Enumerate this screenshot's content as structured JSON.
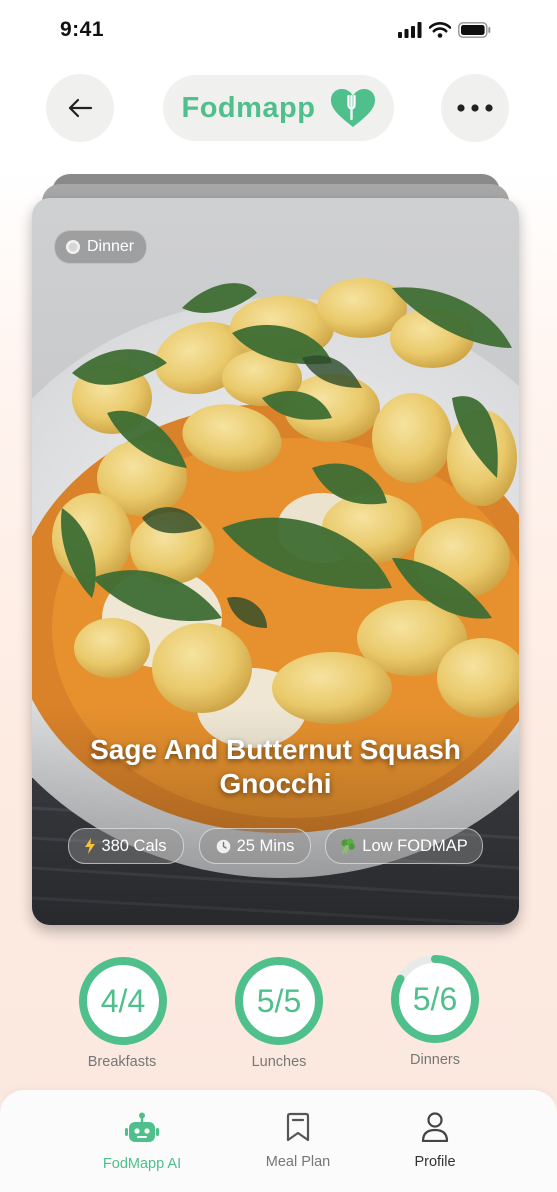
{
  "status_bar": {
    "time": "9:41"
  },
  "header": {
    "brand": "Fodmapp"
  },
  "recipe": {
    "meal_type": "Dinner",
    "title_line1": "Sage And Butternut Squash",
    "title_line2": "Gnocchi",
    "calories": "380 Cals",
    "time": "25 Mins",
    "diet": "Low FODMAP"
  },
  "progress": [
    {
      "label": "4/4",
      "caption": "Breakfasts",
      "fraction": 1.0
    },
    {
      "label": "5/5",
      "caption": "Lunches",
      "fraction": 1.0
    },
    {
      "label": "5/6",
      "caption": "Dinners",
      "fraction": 0.833
    }
  ],
  "nav": {
    "items": [
      {
        "label": "FodMapp AI",
        "icon": "robot-icon",
        "active": true
      },
      {
        "label": "Meal Plan",
        "icon": "bookmark-icon",
        "active": false
      },
      {
        "label": "Profile",
        "icon": "user-icon",
        "active": false
      }
    ]
  },
  "colors": {
    "accent": "#4fbf8c",
    "ring_track": "#e6ebe8"
  }
}
